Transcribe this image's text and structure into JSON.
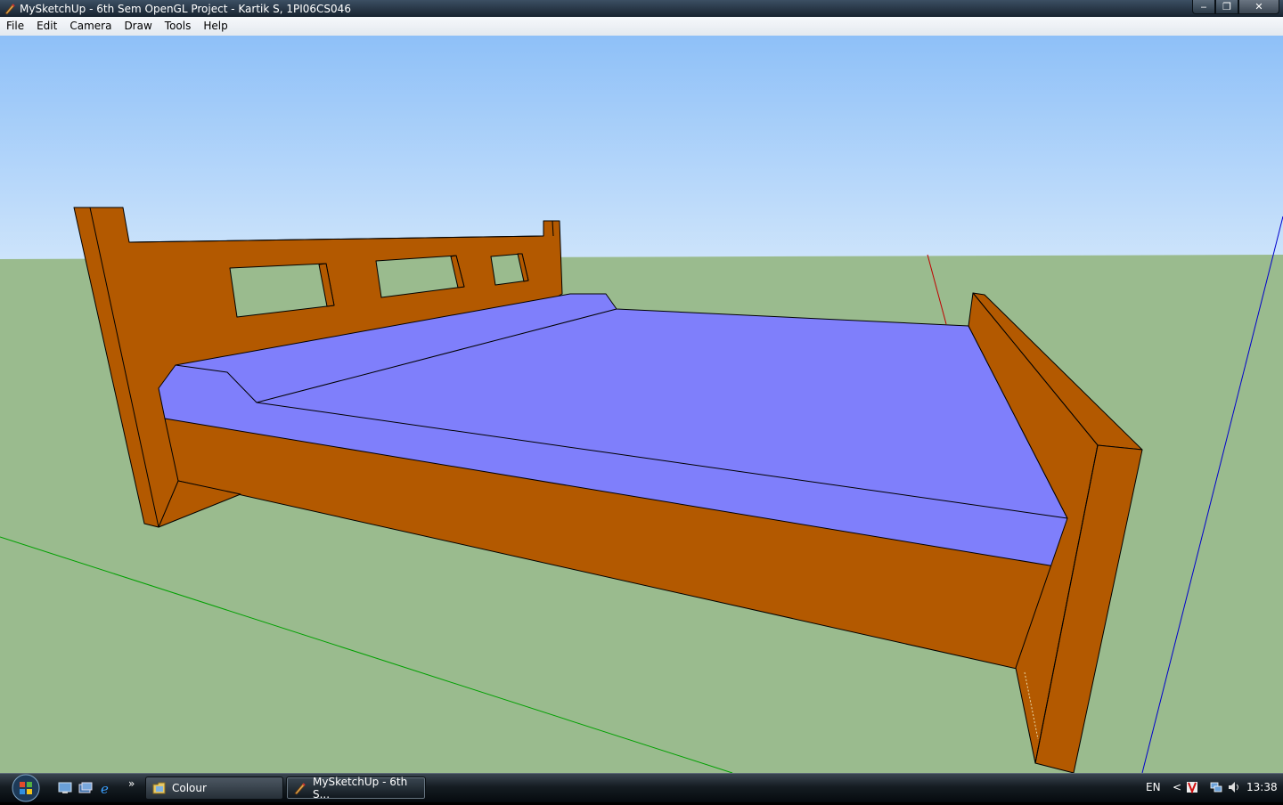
{
  "window": {
    "title": "MySketchUp - 6th Sem OpenGL Project - Kartik S, 1PI06CS046",
    "min_glyph": "‒",
    "max_glyph": "❐",
    "close_glyph": "✕"
  },
  "menu": [
    {
      "label": "File"
    },
    {
      "label": "Edit"
    },
    {
      "label": "Camera"
    },
    {
      "label": "Draw"
    },
    {
      "label": "Tools"
    },
    {
      "label": "Help"
    }
  ],
  "scene": {
    "sky_top": "#8ec0f8",
    "sky_bottom": "#cfe5fb",
    "ground": "#9abb8e",
    "wood": "#b35900",
    "mattress": "#7f7ffb",
    "axis_red": "#c00000",
    "axis_green": "#00a000",
    "axis_blue": "#0000cc"
  },
  "taskbar": {
    "overflow_glyph": "»",
    "buttons": [
      {
        "label": "Colour",
        "icon": "folder-icon"
      },
      {
        "label": "MySketchUp - 6th S...",
        "icon": "app-icon"
      }
    ],
    "language": "EN",
    "tray_chevron": "<",
    "clock": "13:38"
  }
}
